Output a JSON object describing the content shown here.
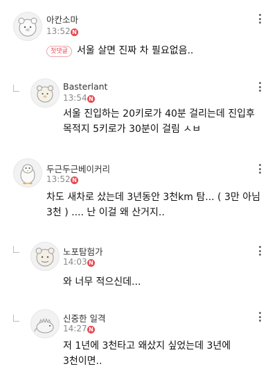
{
  "comments": [
    {
      "author": "아칸소마",
      "time": "13:52",
      "new_badge": "N",
      "first_badge": "첫댓글",
      "text": "서울 살면 진짜 차 필요없음..",
      "is_reply": false,
      "avatar_icon": "bear-face-icon"
    },
    {
      "author": "Basterlant",
      "time": "13:54",
      "new_badge": "N",
      "text": "서울 진입하는 20키로가 40분 걸리는데 진입후\n목적지 5키로가 30분이 걸림 ㅅㅂ",
      "is_reply": true,
      "avatar_icon": "bear-face-icon"
    },
    {
      "author": "두근두근베이커리",
      "time": "13:52",
      "new_badge": "N",
      "text": "차도 새차로 샀는데 3년동안 3천km 탐... ( 3만 아님\n3천 ) .... 난 이걸 왜 산거지..",
      "is_reply": false,
      "avatar_icon": "penguin-icon"
    },
    {
      "author": "노포탐험가",
      "time": "14:03",
      "new_badge": "N",
      "text": "와 너무 적으신데...",
      "is_reply": true,
      "avatar_icon": "bear-face-icon"
    },
    {
      "author": "신중한 일격",
      "time": "14:27",
      "new_badge": "N",
      "text": "저 1년에 3천타고 왜샀지 싶었는데 3년에\n3천이면..",
      "is_reply": true,
      "avatar_icon": "dinosaur-icon"
    }
  ],
  "colors": {
    "accent_red": "#e8474f",
    "muted": "#888888"
  }
}
